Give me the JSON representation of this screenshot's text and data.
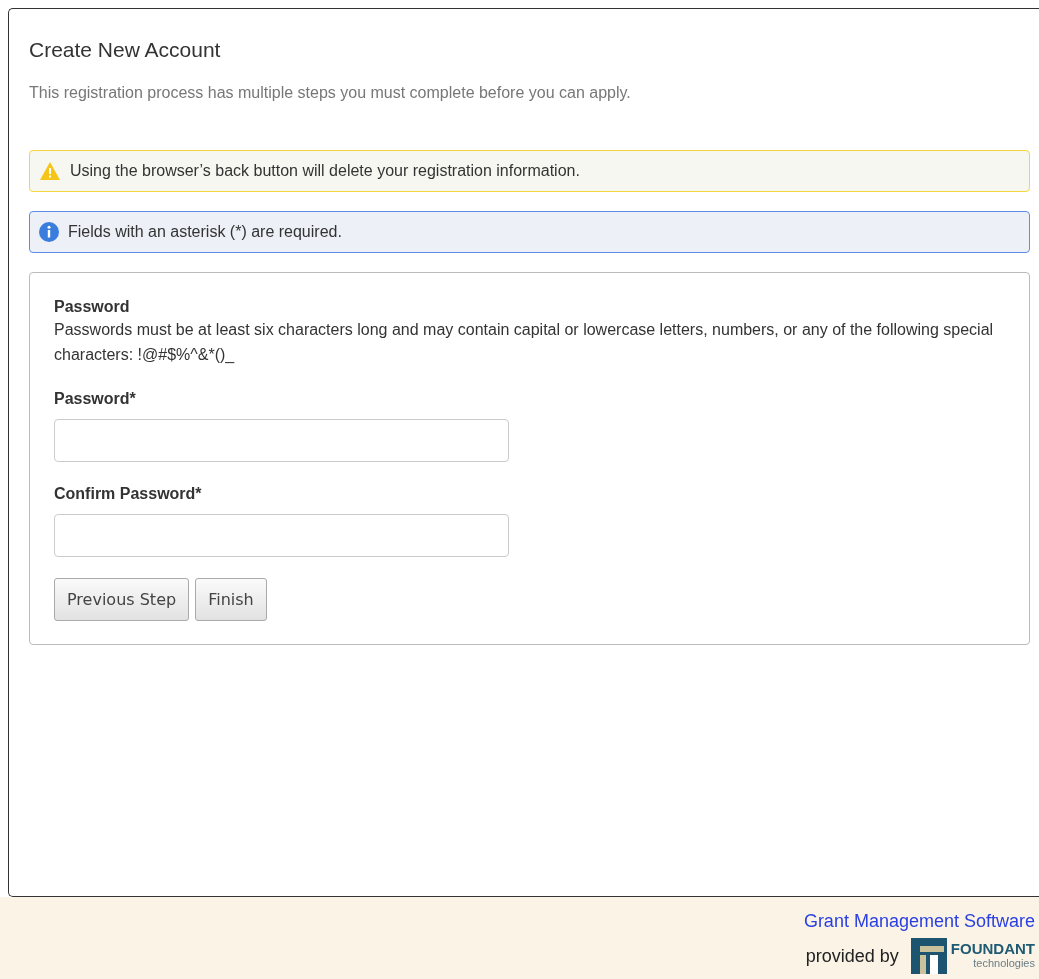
{
  "page": {
    "title": "Create New Account",
    "subtitle": "This registration process has multiple steps you must complete before you can apply."
  },
  "alerts": [
    {
      "kind": "warning",
      "text": "Using the browser’s back button will delete your registration information."
    },
    {
      "kind": "info",
      "text": "Fields with an asterisk (*) are required."
    }
  ],
  "form": {
    "section_title": "Password",
    "help": "Passwords must be at least six characters long and may contain capital or lowercase letters, numbers, or any of the following special characters: !@#$%^&*()_",
    "fields": [
      {
        "label": "Password*"
      },
      {
        "label": "Confirm Password*"
      }
    ],
    "buttons": [
      "Previous Step",
      "Finish"
    ]
  },
  "footer": {
    "link": "Grant Management Software",
    "provided_by": "provided by",
    "logo_name": "FOUNDANT",
    "logo_sub": "technologies"
  }
}
